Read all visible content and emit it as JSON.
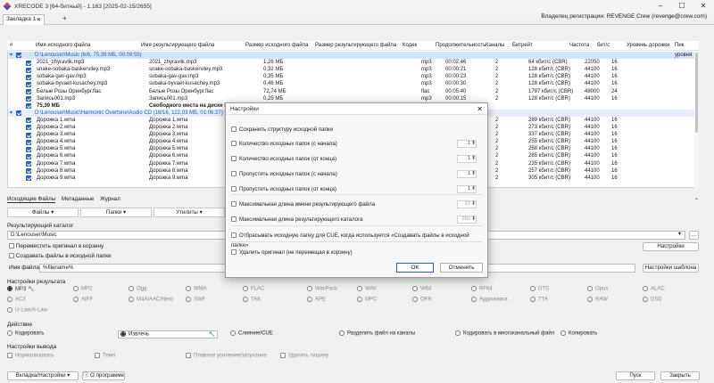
{
  "window": {
    "title": "XRECODE 3 [64-битный] - 1.163 [2025-02-15/2655]"
  },
  "tabs": [
    {
      "label": "Закладка 1"
    }
  ],
  "owner": "Владелец регистрации: REVENGE Crew (revenge@crew.com)",
  "columns": [
    "#",
    "Имя исходного файла",
    "Имя результирующего файла",
    "Размер исходного файла",
    "Размер результирующего файла",
    "Кодек",
    "Продолжительность",
    "Каналы",
    "Битрейт",
    "Частота",
    "бит/с",
    "Уровень дорожки",
    "Пик уровня"
  ],
  "group1": {
    "path": "D:\\Lenouser\\Music (6/6, 75,39 МБ, 00:09:55)"
  },
  "rows1": [
    {
      "src": "2021_zhyravlik.mp3",
      "dst": "2021_zhyravlik.mp3",
      "size": "1,26 МБ",
      "codec": "mp3",
      "dur": "00:02:46",
      "ch": "2",
      "br": "64 кбит/с (CBR)",
      "freq": "22050",
      "bits": "16"
    },
    {
      "src": "snake-sobaka-baskerviley.mp3",
      "dst": "snake-sobaka-baskerviley.mp3",
      "size": "0,32 МБ",
      "codec": "mp3",
      "dur": "00:00:21",
      "ch": "2",
      "br": "128 кбит/с (CBR)",
      "freq": "44100",
      "bits": "16"
    },
    {
      "src": "sobaka-gav-gav.mp3",
      "dst": "sobaka-gav-gav.mp3",
      "size": "0,35 МБ",
      "codec": "mp3",
      "dur": "00:00:23",
      "ch": "2",
      "br": "128 кбит/с (CBR)",
      "freq": "44100",
      "bits": "16"
    },
    {
      "src": "sobaka-byvaet-kusachey.mp3",
      "dst": "sobaka-byvaet-kusachey.mp3",
      "size": "0,46 МБ",
      "codec": "mp3",
      "dur": "00:00:30",
      "ch": "2",
      "br": "128 кбит/с (CBR)",
      "freq": "44100",
      "bits": "16"
    },
    {
      "src": "Белые Розы Оренбург.flac",
      "dst": "Белые Розы Оренбург.flac",
      "size": "72,74 МБ",
      "codec": "flac",
      "dur": "00:05:40",
      "ch": "2",
      "br": "1797 кбит/с (CBR)",
      "freq": "48000",
      "bits": "24"
    },
    {
      "src": "Запись001.mp3",
      "dst": "Запись001.mp3",
      "size": "0,25 МБ",
      "codec": "mp3",
      "dur": "00:00:15",
      "ch": "2",
      "br": "128 кбит/с (CBR)",
      "freq": "44100",
      "bits": "16"
    }
  ],
  "summary1": {
    "size": "75,39 МБ",
    "free": "Свободного места на диске D:"
  },
  "group2": {
    "path": "D:\\Lenouser\\Music\\Harmonic Overtone\\Audio CD (16/16, 122,03 МБ, 01:06:27)"
  },
  "rows2": [
    {
      "src": "Дорожка 1.wma",
      "dst": "Дорожка 1.wma",
      "br": "289 кбит/с (CBR)",
      "freq": "44100",
      "bits": "16"
    },
    {
      "src": "Дорожка 2.wma",
      "dst": "Дорожка 2.wma",
      "br": "273 кбит/с (CBR)",
      "freq": "44100",
      "bits": "16"
    },
    {
      "src": "Дорожка 3.wma",
      "dst": "Дорожка 3.wma",
      "br": "337 кбит/с (CBR)",
      "freq": "44100",
      "bits": "16"
    },
    {
      "src": "Дорожка 4.wma",
      "dst": "Дорожка 4.wma",
      "br": "255 кбит/с (CBR)",
      "freq": "44100",
      "bits": "16"
    },
    {
      "src": "Дорожка 5.wma",
      "dst": "Дорожка 5.wma",
      "br": "258 кбит/с (CBR)",
      "freq": "44100",
      "bits": "16"
    },
    {
      "src": "Дорожка 6.wma",
      "dst": "Дорожка 6.wma",
      "br": "285 кбит/с (CBR)",
      "freq": "44100",
      "bits": "16"
    },
    {
      "src": "Дорожка 7.wma",
      "dst": "Дорожка 7.wma",
      "br": "235 кбит/с (CBR)",
      "freq": "44100",
      "bits": "16"
    },
    {
      "src": "Дорожка 8.wma",
      "dst": "Дорожка 8.wma",
      "br": "257 кбит/с (CBR)",
      "freq": "44100",
      "bits": "16"
    },
    {
      "src": "Дорожка 9.wma",
      "dst": "Дорожка 9.wma",
      "br": "305 кбит/с (CBR)",
      "freq": "44100",
      "bits": "16"
    }
  ],
  "panelTabs": [
    "Исходящие Файлы",
    "Метаданные",
    "Журнал"
  ],
  "menuButtons": [
    "Файлы",
    "Папки",
    "Утилиты"
  ],
  "outputDir": {
    "label": "Результирующий каталог",
    "value": "D:\\Lenouser\\Music",
    "move": "Переместить оригинал в корзину",
    "create": "Создавать файлы в исходной папке",
    "settings": "Настройки"
  },
  "fileName": {
    "label": "Имя файла:",
    "value": "%filename%",
    "template": "Настройки шаблона"
  },
  "resultSettings": {
    "label": "Настройки результата",
    "formats": [
      "MP3",
      "MP2",
      "Ogg",
      "WMA",
      "FLAC",
      "WavPack",
      "WAV",
      "W64",
      "RF64",
      "DTS",
      "Opus",
      "ALAC",
      "AC3",
      "AIFF",
      "M4A/AAC/Nero",
      "SWF",
      "TAK",
      "APE",
      "MPC",
      "OFR",
      "Аудиокнига",
      "TTA",
      "RAW",
      "DSD",
      "U-Law/A-Law"
    ]
  },
  "action": {
    "label": "Действие",
    "items": [
      "Кодировать",
      "Извлечь",
      "Слияние/CUE",
      "Разделить файл на каналы",
      "Кодировать в многоканальный файл",
      "Копировать"
    ]
  },
  "outputSettings": {
    "label": "Настройки вывода",
    "items": [
      "Нормализовать",
      "Темп",
      "Плавное усиление/затухание",
      "Удалить тишину"
    ]
  },
  "bottom": {
    "tabSettings": "Вкладка/Настройки",
    "about": "О программе",
    "start": "Пуск",
    "close": "Закрыть"
  },
  "dialog": {
    "title": "Настройки",
    "items": [
      {
        "label": "Сохранить структуру исходной папки"
      },
      {
        "label": "Количество исходных папок (с начала)",
        "value": "1"
      },
      {
        "label": "Количество исходных папок (от конца)",
        "value": "1"
      },
      {
        "label": "Пропустить исходных папок (с начала)",
        "value": "1"
      },
      {
        "label": "Пропустить исходных папок (от конца)",
        "value": "1"
      },
      {
        "label": "Максимальная длина имени результирующего файла",
        "value": "37"
      },
      {
        "label": "Максимальная длина результирующего каталога",
        "value": "260"
      },
      {
        "label": "Отбрасывать исходную папку для CUE, когда используется «Создавать файлы в исходной папке»"
      },
      {
        "label": "Удалить оригинал (не перемещая в корзину)"
      }
    ],
    "ok": "OK",
    "cancel": "Отменить"
  }
}
